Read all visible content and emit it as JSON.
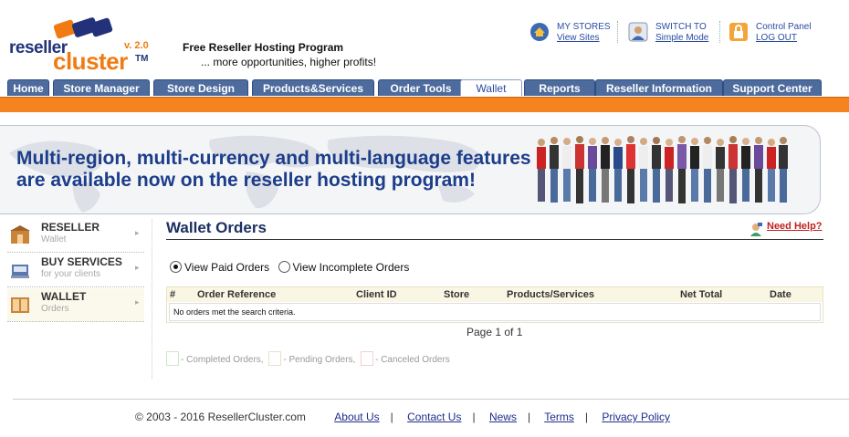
{
  "logo": {
    "word1": "reseller",
    "word2": "cluster",
    "version": "v. 2.0",
    "tm": "TM"
  },
  "header": {
    "tagline": "Free Reseller Hosting Program",
    "subtagline": "... more opportunities, higher profits!",
    "links": [
      {
        "title": "MY STORES",
        "link": "View Sites",
        "icon": "home-icon"
      },
      {
        "title": "SWITCH TO",
        "link": "Simple Mode",
        "icon": "switch-icon"
      },
      {
        "title": "Control Panel",
        "link": "LOG OUT",
        "icon": "lock-icon"
      }
    ]
  },
  "tabs": [
    "Home",
    "Store Manager",
    "Store Design",
    "Products&Services",
    "Order Tools",
    "Wallet",
    "Reports",
    "Reseller Information",
    "Support Center"
  ],
  "active_tab": "Wallet",
  "banner": {
    "line1": "Multi-region, multi-currency and multi-language features",
    "line2": "are available now on the reseller hosting program!"
  },
  "leftnav": [
    {
      "title": "RESELLER",
      "sub": "Wallet",
      "icon": "store-icon"
    },
    {
      "title": "BUY SERVICES",
      "sub": "for your clients",
      "icon": "cart-icon"
    },
    {
      "title": "WALLET",
      "sub": "Orders",
      "icon": "wallet-icon"
    }
  ],
  "main": {
    "title": "Wallet Orders",
    "help": "Need Help?",
    "radios": [
      "View Paid Orders",
      "View Incomplete Orders"
    ],
    "columns": [
      "#",
      "Order Reference",
      "Client ID",
      "Store",
      "Products/Services",
      "Net Total",
      "Date"
    ],
    "empty_message": "No orders met the search criteria.",
    "pagination": "Page 1 of 1",
    "legend": [
      {
        "label": "- Completed Orders,",
        "color": "#cde8c4"
      },
      {
        "label": "- Pending Orders,",
        "color": "#e9e1c8"
      },
      {
        "label": "- Canceled Orders",
        "color": "#f3d0d0"
      }
    ]
  },
  "footer": {
    "copyright": "© 2003 - 2016 ResellerCluster.com",
    "links": [
      "About Us",
      "Contact Us",
      "News",
      "Terms",
      "Privacy Policy"
    ]
  },
  "colors": {
    "accent": "#f58320",
    "tab": "#4d6b9c",
    "brand_blue": "#1c3d8a"
  }
}
